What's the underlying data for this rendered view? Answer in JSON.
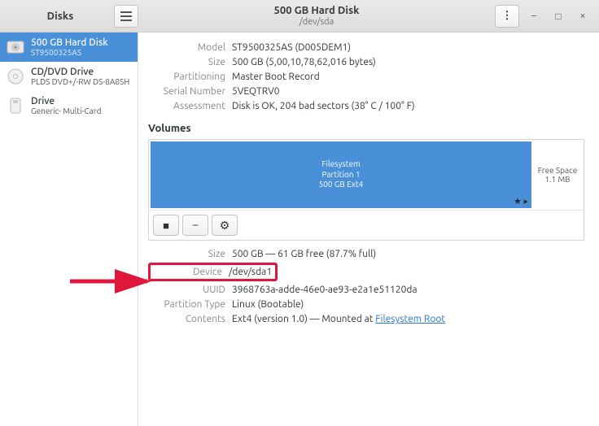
{
  "header": {
    "app_name": "Disks",
    "title": "500 GB Hard Disk",
    "subtitle": "/dev/sda"
  },
  "sidebar": {
    "items": [
      {
        "title": "500 GB Hard Disk",
        "sub": "ST9500325AS"
      },
      {
        "title": "CD/DVD Drive",
        "sub": "PLDS DVD+/-RW DS-8A8SH"
      },
      {
        "title": "Drive",
        "sub": "Generic- Multi-Card"
      }
    ]
  },
  "details": {
    "model_label": "Model",
    "model": "ST9500325AS (D005DEM1)",
    "size_label": "Size",
    "size": "500 GB (5,00,10,78,62,016 bytes)",
    "part_label": "Partitioning",
    "part": "Master Boot Record",
    "serial_label": "Serial Number",
    "serial": "5VEQTRV0",
    "assess_label": "Assessment",
    "assess": "Disk is OK, 204 bad sectors (38° C / 100° F)"
  },
  "volumes": {
    "heading": "Volumes",
    "partition": {
      "line1": "Filesystem",
      "line2": "Partition 1",
      "line3": "500 GB Ext4"
    },
    "free": {
      "line1": "Free Space",
      "line2": "1.1 MB"
    }
  },
  "partition_details": {
    "size_label": "Size",
    "size": "500 GB — 61 GB free (87.7% full)",
    "device_label": "Device",
    "device": "/dev/sda1",
    "uuid_label": "UUID",
    "uuid": "3968763a-adde-46e0-ae93-e2a1e51120da",
    "ptype_label": "Partition Type",
    "ptype": "Linux (Bootable)",
    "contents_label": "Contents",
    "contents_pre": "Ext4 (version 1.0) — Mounted at ",
    "contents_link": "Filesystem Root"
  }
}
